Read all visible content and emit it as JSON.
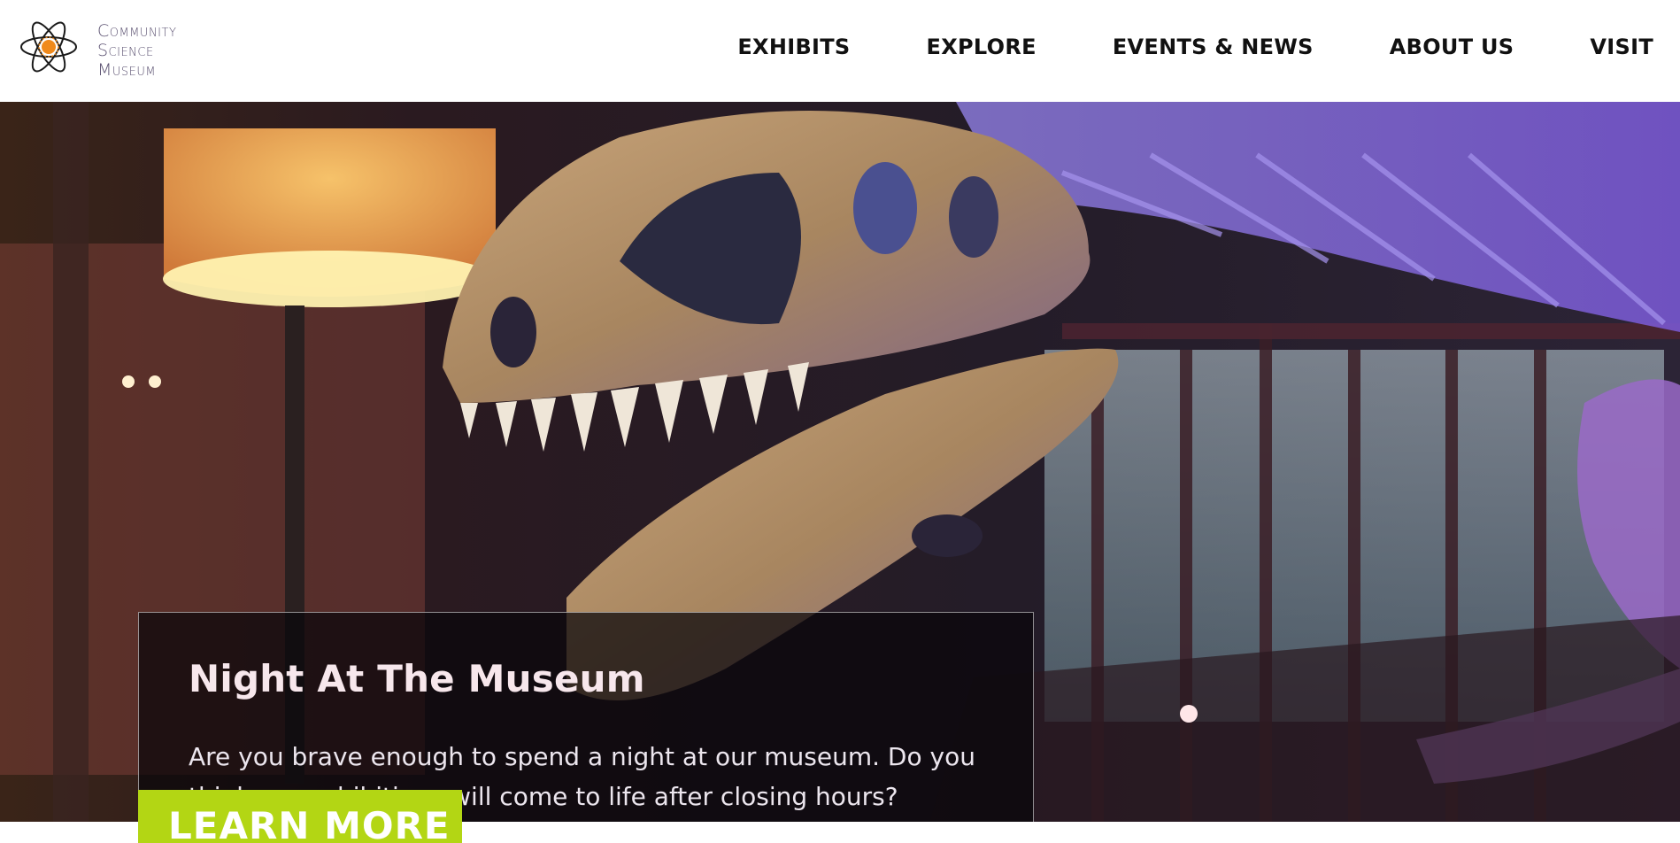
{
  "site": {
    "logo_line1": "Community",
    "logo_line2": "Science",
    "logo_line3": "Museum",
    "logo_icon": "atom-icon",
    "accent_color": "#b3d614",
    "logo_accent_color": "#f08a1c"
  },
  "nav": {
    "items": [
      {
        "label": "EXHIBITS"
      },
      {
        "label": "EXPLORE"
      },
      {
        "label": "EVENTS & NEWS"
      },
      {
        "label": "ABOUT US"
      },
      {
        "label": "VISIT"
      }
    ]
  },
  "hero": {
    "title": "Night At The Museum",
    "body": "Are you brave enough to spend a night at our museum. Do you think our exhibitions will come to life after closing hours?",
    "cta_label": "LEARN MORE",
    "image": "dinosaur-skeleton-photo"
  }
}
